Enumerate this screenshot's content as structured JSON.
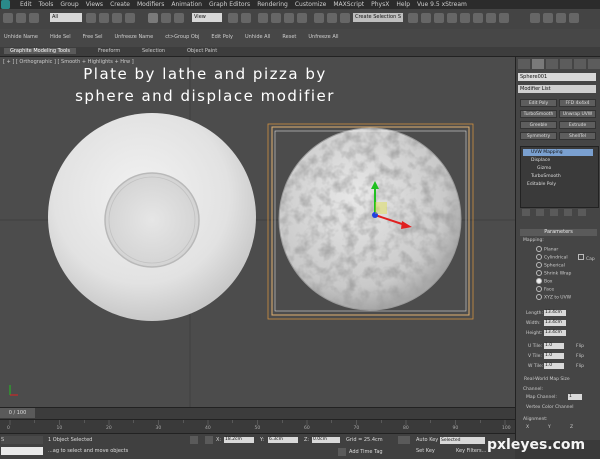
{
  "menubar": {
    "items": [
      "Edit",
      "Tools",
      "Group",
      "Views",
      "Create",
      "Modifiers",
      "Animation",
      "Graph Editors",
      "Rendering",
      "Customize",
      "MAXScript",
      "PhysX",
      "Help",
      "Vue 9.5 xStream"
    ]
  },
  "toolbar": {
    "selection_filter": "All",
    "reference_coord": "View",
    "named_selection": "Create Selection S"
  },
  "ribbon": {
    "items": [
      "Unhide Name",
      "Hide Sel",
      "Free Sel",
      "Unfreeze Name",
      "ct>Group Obj",
      "Edit Poly",
      "Unhide All",
      "Reset",
      "Unfreeze All"
    ],
    "tabs": [
      "Graphite Modeling Tools",
      "Freeform",
      "Selection",
      "Object Paint"
    ]
  },
  "viewport": {
    "label": "[ + ] [ Orthographic ] [ Smooth + Highlights + Hrw ]",
    "caption_line1": "Plate by lathe and pizza by",
    "caption_line2": "sphere and displace modifier"
  },
  "command_panel": {
    "object_name": "Sphere001",
    "modifier_list": "Modifier List",
    "buttons": [
      "Edit Poly",
      "FFD 4x4x4",
      "TurboSmooth",
      "Unwrap UVW",
      "Greeble",
      "Extrude",
      "Symmetry",
      "ShellTel"
    ],
    "stack": [
      "UVW Mapping",
      "Displace",
      "Gizmo",
      "TurboSmooth",
      "Editable Poly"
    ],
    "params_title": "Parameters",
    "mapping_label": "Mapping:",
    "mapping_options": [
      "Planar",
      "Cylindrical",
      "Spherical",
      "Shrink Wrap",
      "Box",
      "Face",
      "XYZ to UVW"
    ],
    "cap_label": "Cap",
    "dims": [
      {
        "label": "Length:",
        "value": "13.4cm"
      },
      {
        "label": "Width:",
        "value": "13.4cm"
      },
      {
        "label": "Height:",
        "value": "13.4cm"
      }
    ],
    "tiles": [
      {
        "label": "U Tile:",
        "value": "1.0",
        "flip": "Flip"
      },
      {
        "label": "V Tile:",
        "value": "1.0",
        "flip": "Flip"
      },
      {
        "label": "W Tile:",
        "value": "1.0",
        "flip": "Flip"
      }
    ],
    "real_world": "Real-World Map Size",
    "channel_label": "Channel:",
    "map_channel": "Map Channel:",
    "map_channel_value": "1",
    "vertex_color": "Vertex Color Channel",
    "alignment": "Alignment:",
    "axis": [
      "X",
      "Y",
      "Z"
    ]
  },
  "timeline": {
    "frame": "0 / 100",
    "ticks": [
      "0",
      "10",
      "20",
      "30",
      "40",
      "50",
      "60",
      "70",
      "80",
      "90",
      "100"
    ]
  },
  "status": {
    "selected": "1 Object Selected",
    "prompt": "...ag to select and move objects",
    "x_label": "X:",
    "x_value": "18.2cm",
    "y_label": "Y:",
    "y_value": "6.3cm",
    "z_label": "Z:",
    "z_value": "0.0cm",
    "grid": "Grid = 25.4cm",
    "auto_key": "Auto Key",
    "set_key": "Set Key",
    "key_mode": "Selected",
    "key_filters": "Key Filters...",
    "add_time_tag": "Add Time Tag",
    "maxscript": "S"
  },
  "watermark": "pxleyes.com"
}
